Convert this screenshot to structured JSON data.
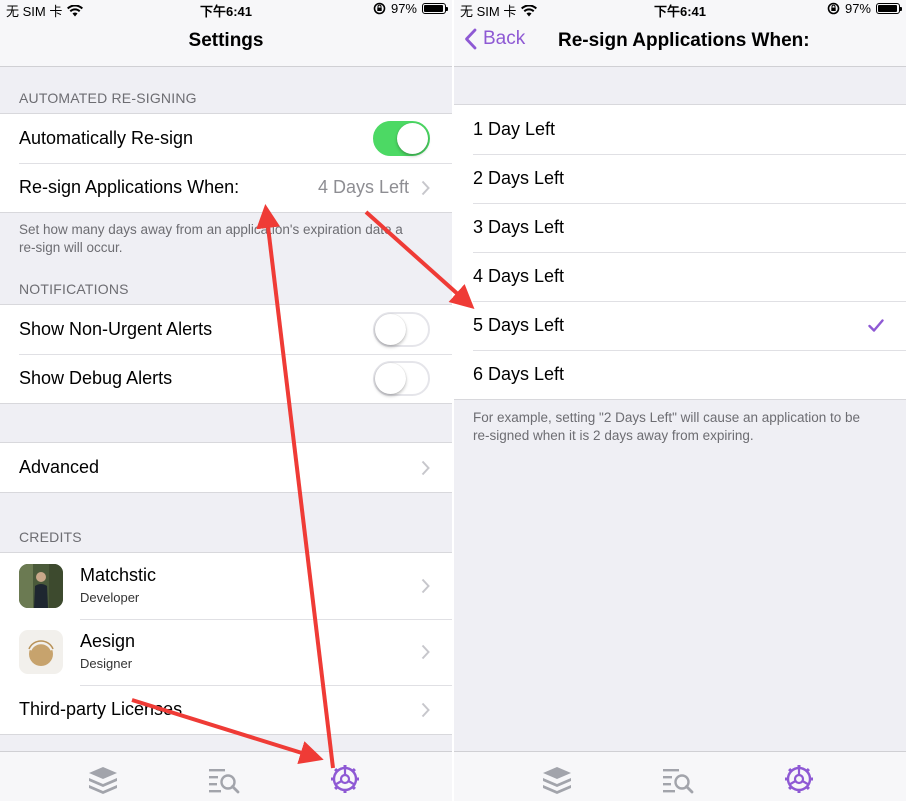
{
  "colors": {
    "accent": "#8e59d4",
    "toggle_on": "#4cd964",
    "arrow": "#ef3b36"
  },
  "status": {
    "carrier": "无 SIM 卡",
    "time": "下午6:41",
    "battery": "97%",
    "battery_level": 0.97
  },
  "left": {
    "title": "Settings",
    "automated": {
      "header": "AUTOMATED RE-SIGNING",
      "auto_label": "Automatically Re-sign",
      "auto_on": true,
      "resign_label": "Re-sign Applications When:",
      "resign_value": "4 Days Left",
      "footer": "Set how many days away from an application's expiration date a re-sign will occur."
    },
    "notifications": {
      "header": "NOTIFICATIONS",
      "non_urgent_label": "Show Non-Urgent Alerts",
      "non_urgent_on": false,
      "debug_label": "Show Debug Alerts",
      "debug_on": false
    },
    "advanced_label": "Advanced",
    "credits": {
      "header": "CREDITS",
      "people": [
        {
          "name": "Matchstic",
          "role": "Developer"
        },
        {
          "name": "Aesign",
          "role": "Designer"
        }
      ],
      "licenses_label": "Third-party Licenses"
    }
  },
  "right": {
    "back_label": "Back",
    "title": "Re-sign Applications When:",
    "options": [
      "1 Day Left",
      "2 Days Left",
      "3 Days Left",
      "4 Days Left",
      "5 Days Left",
      "6 Days Left"
    ],
    "selected_index": 4,
    "footer": "For example, setting \"2 Days Left\" will cause an application to be re-signed when it is 2 days away from expiring."
  },
  "tabbar": {
    "icons": [
      "stack-icon",
      "search-list-icon",
      "settings-gear-icon"
    ],
    "selected_index": 2
  }
}
